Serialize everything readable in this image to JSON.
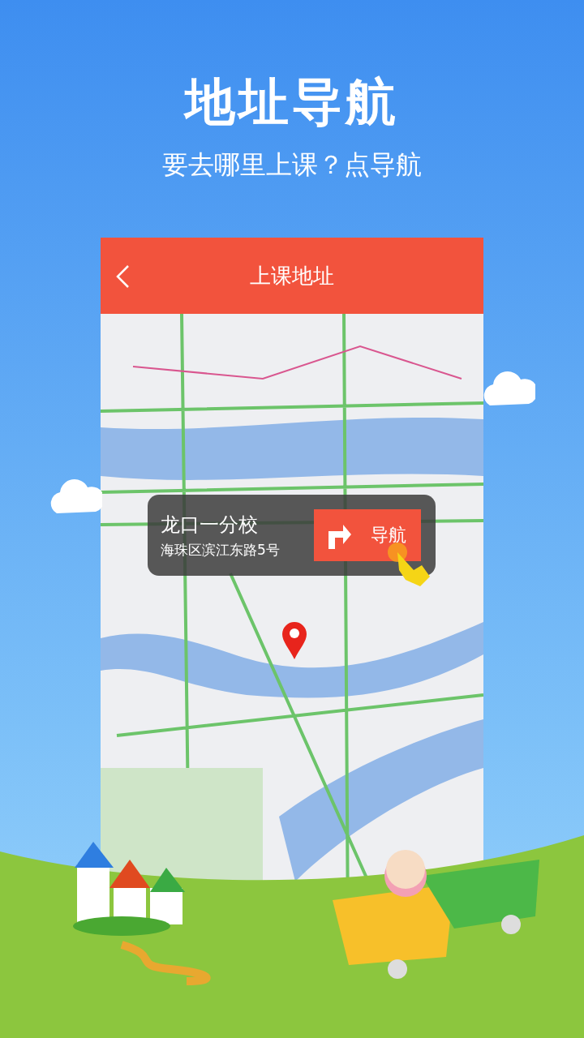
{
  "headline": "地址导航",
  "tagline": "要去哪里上课？点导航",
  "screen": {
    "header": {
      "title": "上课地址"
    },
    "location_card": {
      "name": "龙口一分校",
      "address": "海珠区滨江东路5号",
      "nav_button": "导航"
    }
  }
}
